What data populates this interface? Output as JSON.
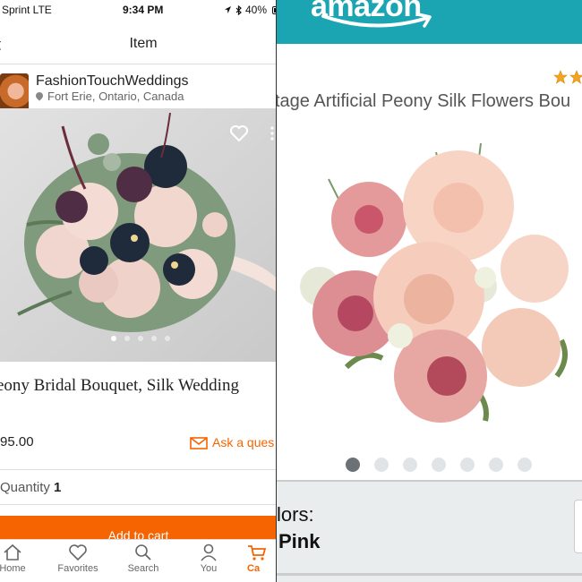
{
  "status_bar": {
    "carrier": "Sprint  LTE",
    "time": "9:34 PM",
    "battery": "40%"
  },
  "etsy": {
    "nav_title": "Item",
    "shop_name": "FashionTouchWeddings",
    "shop_location": "Fort Erie, Ontario, Canada",
    "item_title": "eony Bridal Bouquet, Silk Wedding",
    "price": "95.00",
    "ask_question": "Ask a ques",
    "quantity_label": "Quantity",
    "quantity_value": "1",
    "add_to_cart": "Add to cart",
    "tabs": [
      {
        "label": "Home",
        "icon": "home-icon"
      },
      {
        "label": "Favorites",
        "icon": "heart-icon"
      },
      {
        "label": "Search",
        "icon": "search-icon"
      },
      {
        "label": "You",
        "icon": "user-icon"
      },
      {
        "label": "Ca",
        "icon": "cart-icon"
      }
    ],
    "brand_color": "#f56400"
  },
  "amazon": {
    "logo": "amazon",
    "product_title": "tage Artificial Peony Silk Flowers Bou",
    "colors_label": "lors:",
    "selected_color": "Pink",
    "header_color": "#1ba5b3"
  }
}
